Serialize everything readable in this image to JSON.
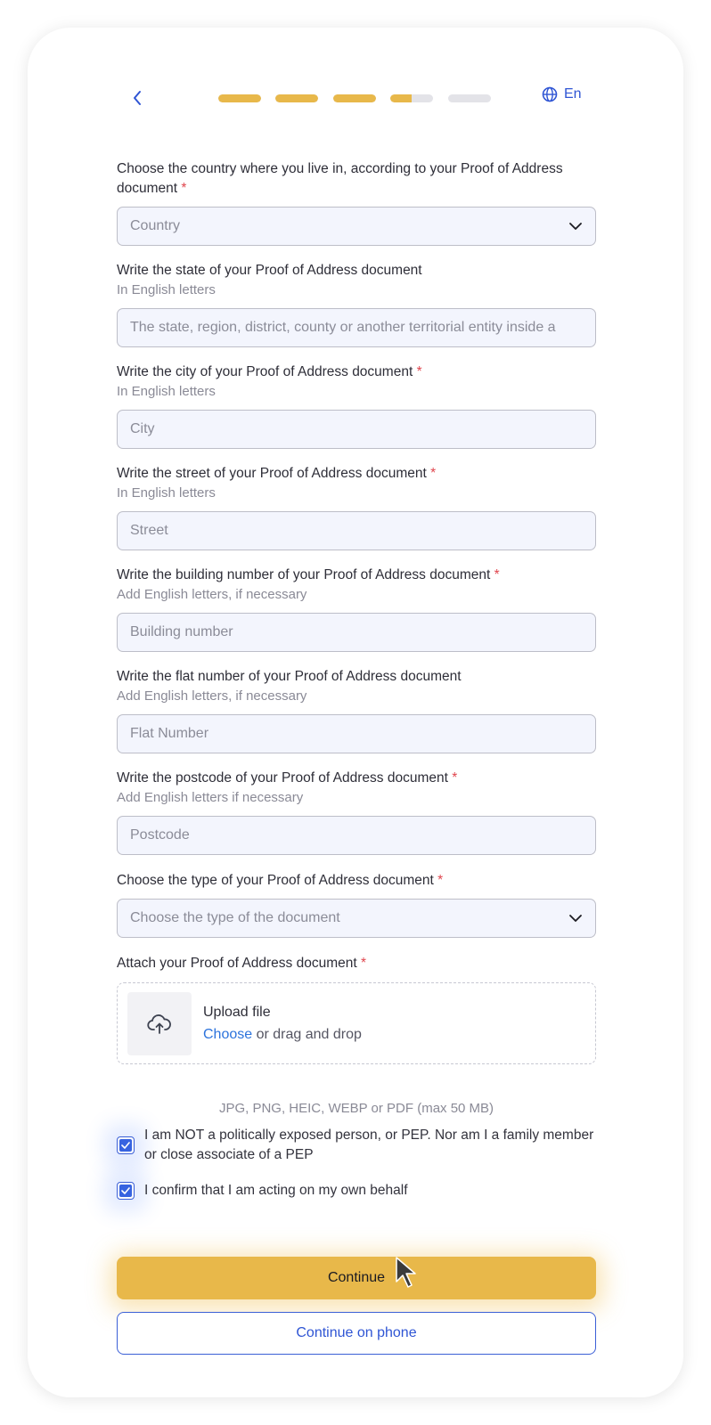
{
  "header": {
    "back_icon": "chevron-left-icon",
    "progress": [
      1,
      1,
      1,
      0.5,
      0
    ],
    "language": "En",
    "language_icon": "globe-icon"
  },
  "fields": {
    "country": {
      "label": "Choose the country where you live in, according to your Proof of Address document",
      "required_mark": "*",
      "placeholder": "Country"
    },
    "state": {
      "label": "Write the state of your Proof of Address document",
      "hint": "In English letters",
      "placeholder": "The state, region, district, county or another territorial entity inside a"
    },
    "city": {
      "label": "Write the city of your Proof of Address document",
      "required_mark": "*",
      "hint": "In English letters",
      "placeholder": "City"
    },
    "street": {
      "label": "Write the street of your Proof of Address document",
      "required_mark": "*",
      "hint": "In English letters",
      "placeholder": "Street"
    },
    "building": {
      "label": "Write the building number of your Proof of Address document",
      "required_mark": "*",
      "hint": "Add English letters, if necessary",
      "placeholder": "Building number"
    },
    "flat": {
      "label": "Write the flat number of your Proof of Address document",
      "hint": "Add English letters, if necessary",
      "placeholder": "Flat Number"
    },
    "postcode": {
      "label": "Write the postcode of your Proof of Address document",
      "required_mark": "*",
      "hint": "Add English letters if necessary",
      "placeholder": "Postcode"
    },
    "doc_type": {
      "label": "Choose the type of your Proof of Address document",
      "required_mark": "*",
      "placeholder": "Choose the type of the document"
    }
  },
  "upload": {
    "label": "Attach your Proof of Address document",
    "required_mark": "*",
    "title": "Upload file",
    "choose": "Choose",
    "drag_text": " or drag and drop",
    "formats": "JPG, PNG, HEIC, WEBP or PDF (max 50 MB)"
  },
  "checkboxes": [
    {
      "text": "I am NOT a politically exposed person, or PEP. Nor am I a family member or close associate of a PEP",
      "checked": true
    },
    {
      "text": "I confirm that I am acting on my own behalf",
      "checked": true
    }
  ],
  "buttons": {
    "continue": "Continue",
    "continue_phone": "Continue on phone"
  },
  "colors": {
    "accent_yellow": "#e8b84a",
    "accent_blue": "#2f55d4",
    "required_red": "#e0464e",
    "progress_empty": "#e3e3e8"
  }
}
